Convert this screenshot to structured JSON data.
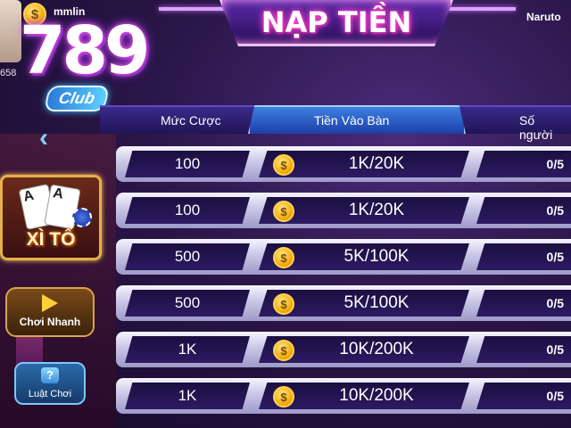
{
  "user": {
    "username": "mmlin",
    "balance": "658"
  },
  "logo": {
    "number": "789",
    "club": "Club"
  },
  "game": {
    "name": "XÌ TỐ"
  },
  "side_buttons": {
    "quick_play": "Chơi Nhanh",
    "rules": "Luật Chơi"
  },
  "header": {
    "title": "NẠP TIỀN",
    "player_name": "Naruto"
  },
  "table": {
    "columns": [
      "Mức Cược",
      "Tiền Vào Bàn",
      "Số người"
    ],
    "rows": [
      {
        "bet": "100",
        "entry": "1K/20K",
        "players": "0/5"
      },
      {
        "bet": "100",
        "entry": "1K/20K",
        "players": "0/5"
      },
      {
        "bet": "500",
        "entry": "5K/100K",
        "players": "0/5"
      },
      {
        "bet": "500",
        "entry": "5K/100K",
        "players": "0/5"
      },
      {
        "bet": "1K",
        "entry": "10K/200K",
        "players": "0/5"
      },
      {
        "bet": "1K",
        "entry": "10K/200K",
        "players": "0/5"
      }
    ]
  },
  "icons": {
    "coin": "coin-icon",
    "back": "chevron-left-icon",
    "play": "play-icon",
    "help": "question-icon"
  },
  "colors": {
    "accent_pink": "#ff3fd0",
    "gold": "#f0a400",
    "header_blue": "#3e7fe0"
  }
}
